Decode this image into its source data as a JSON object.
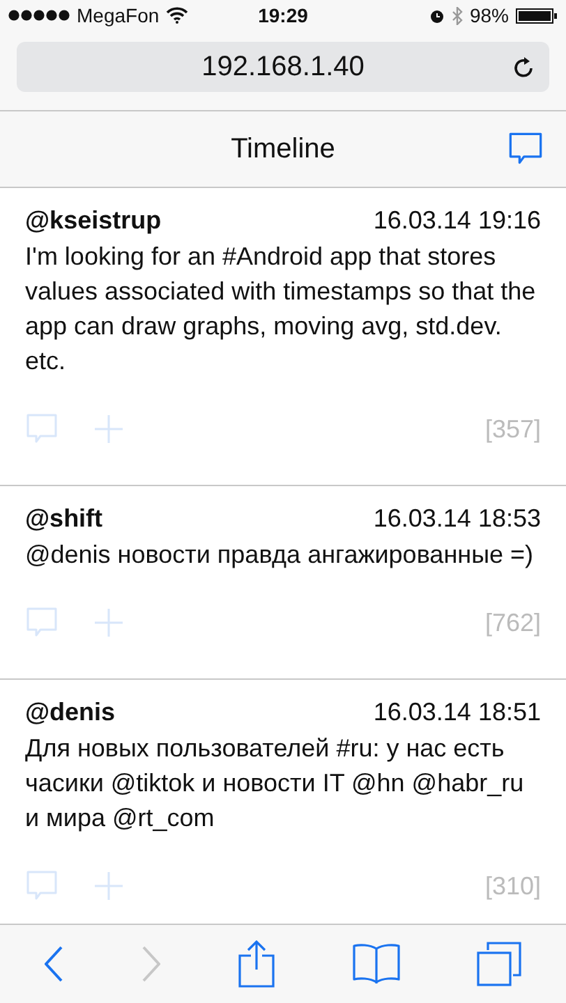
{
  "status_bar": {
    "carrier": "MegaFon",
    "time": "19:29",
    "battery": "98%"
  },
  "address_bar": {
    "url": "192.168.1.40"
  },
  "header": {
    "title": "Timeline"
  },
  "posts": [
    {
      "author": "@kseistrup",
      "date": "16.03.14 19:16",
      "text": "I'm looking for an #Android app that stores values associated with timestamps so that the app can draw graphs, moving avg, std.dev. etc.",
      "count": "[357]"
    },
    {
      "author": "@shift",
      "date": "16.03.14 18:53",
      "text": "@denis новости правда ангажированные =)",
      "count": "[762]"
    },
    {
      "author": "@denis",
      "date": "16.03.14 18:51",
      "text": "Для новых пользователей #ru: у нас есть часики @tiktok и новости IT @hn @habr_ru и мира @rt_com",
      "count": "[310]"
    }
  ],
  "toolbar": [
    {
      "kind": "back",
      "disabled": false
    },
    {
      "kind": "forward",
      "disabled": true
    },
    {
      "kind": "share",
      "disabled": false
    },
    {
      "kind": "bookmarks",
      "disabled": false
    },
    {
      "kind": "tabs",
      "disabled": false
    }
  ]
}
